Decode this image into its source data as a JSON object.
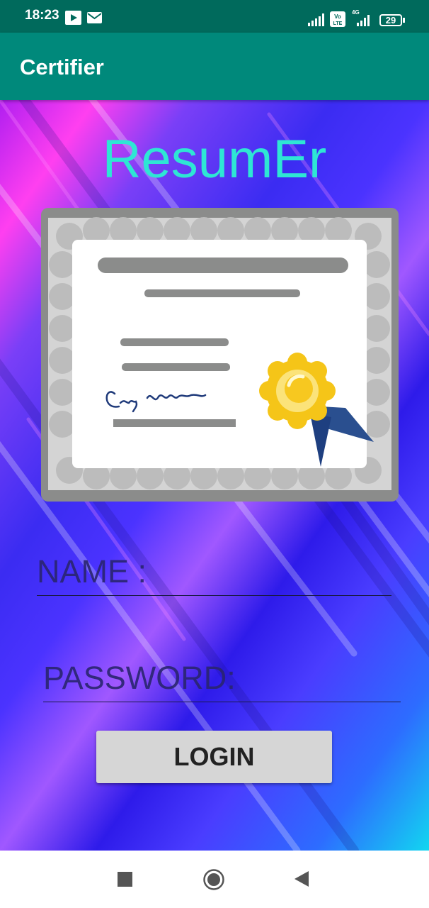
{
  "status_bar": {
    "time": "18:23",
    "battery": "29",
    "network_label": "4G",
    "volte_label": "Vo LTE"
  },
  "app_bar": {
    "title": "Certifier"
  },
  "main": {
    "app_name": "ResumEr",
    "name_field": {
      "placeholder": "NAME :",
      "value": ""
    },
    "password_field": {
      "placeholder": "PASSWORD:",
      "value": ""
    },
    "login_label": "LOGIN"
  },
  "colors": {
    "status_bar": "#006a5c",
    "app_bar": "#00897b",
    "app_name": "#2ee6d4",
    "button": "#d6d6d6"
  },
  "icons": [
    "youtube-icon",
    "mail-icon",
    "signal-icon",
    "volte-icon",
    "battery-icon",
    "certificate-illustration",
    "stop-icon",
    "home-icon",
    "back-icon"
  ]
}
